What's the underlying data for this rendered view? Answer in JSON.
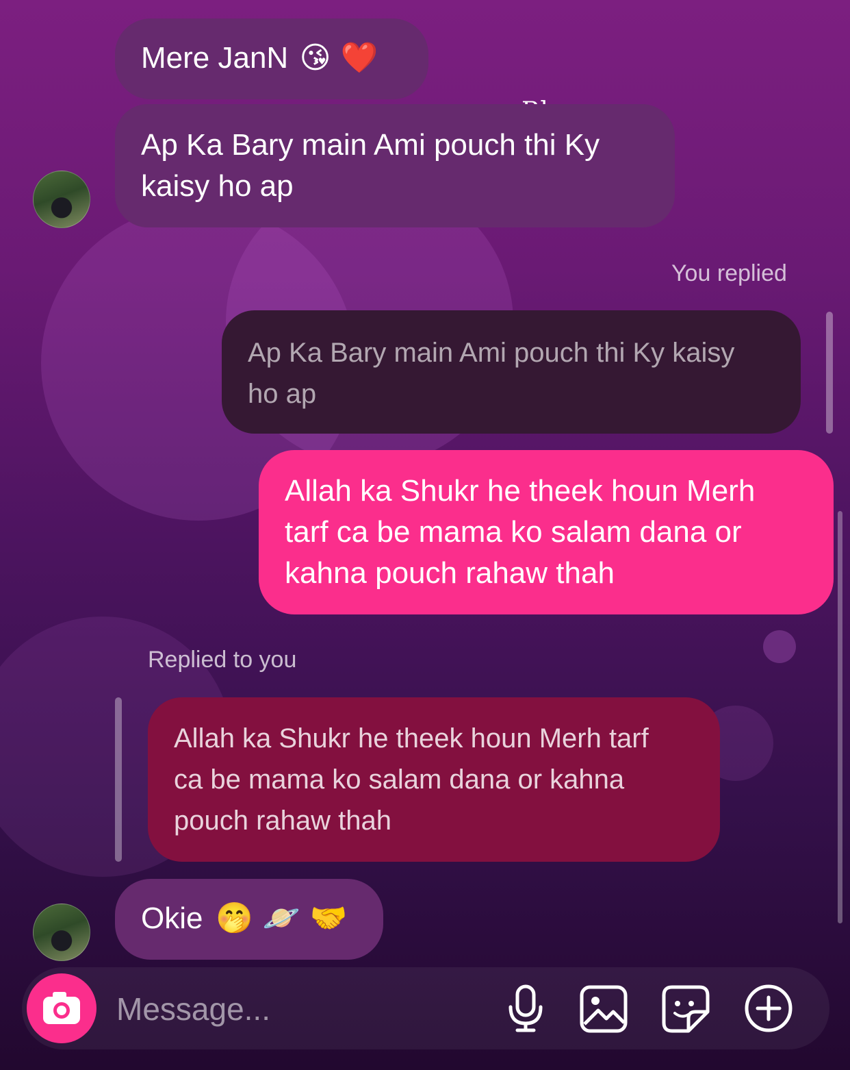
{
  "watermark": "Rhen",
  "messages": {
    "m1": {
      "text": "Mere JanN",
      "emojis": "😘 ❤️"
    },
    "m2": {
      "text": "Ap Ka Bary main Ami pouch thi Ky\nkaisy ho ap"
    },
    "you_replied_label": "You replied",
    "quoted_out": "Ap Ka Bary main Ami pouch thi Ky kaisy\nho ap",
    "m3": {
      "text": "Allah ka Shukr he theek houn Merh\ntarf ca be mama ko salam dana or\nkahna pouch rahaw thah"
    },
    "replied_to_you_label": "Replied to you",
    "quoted_in": "Allah ka Shukr he theek houn Merh tarf\nca be mama ko salam dana or kahna\npouch rahaw thah",
    "m4": {
      "text": "Okie",
      "emojis": "🤭 🪐 🤝"
    }
  },
  "composer": {
    "placeholder": "Message...",
    "icons": [
      "camera-icon",
      "microphone-icon",
      "gallery-icon",
      "sticker-icon",
      "add-icon"
    ]
  },
  "colors": {
    "incoming_bubble": "#662a6e",
    "outgoing_bubble": "#fb2e8c",
    "quoted_outgoing": "#351833",
    "quoted_incoming": "#83103f",
    "camera_button": "#fb2e8c"
  }
}
